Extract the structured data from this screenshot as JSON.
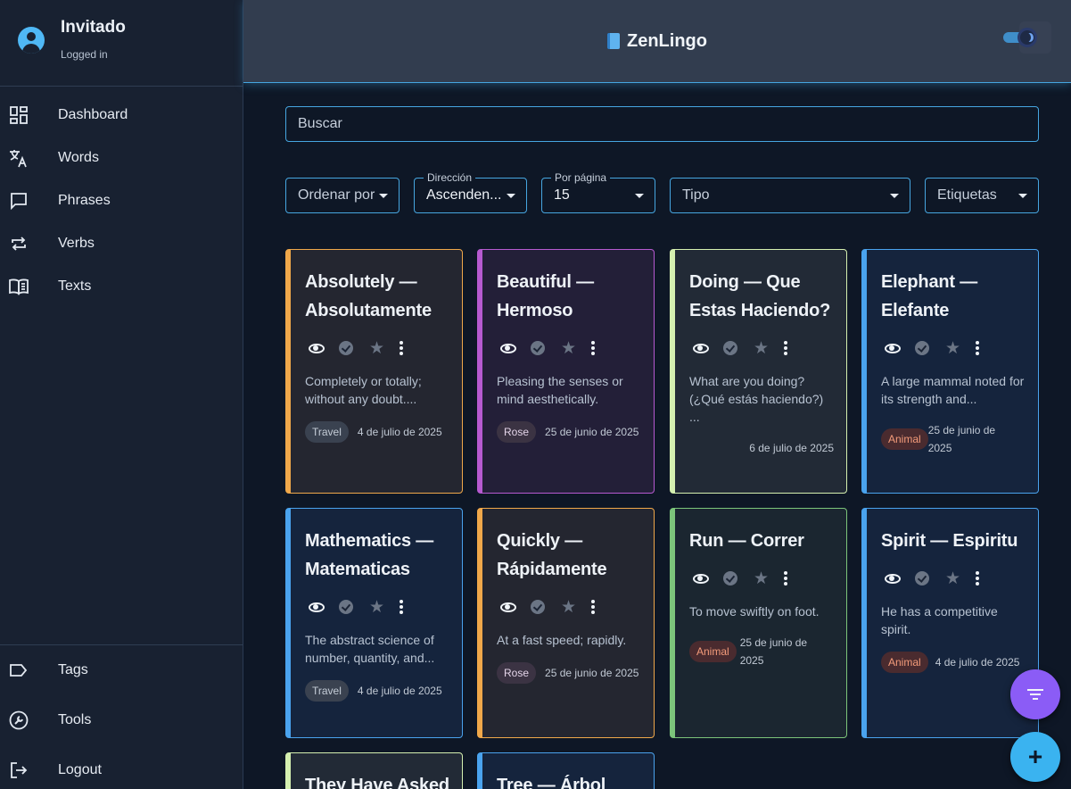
{
  "user": {
    "name": "Invitado",
    "status": "Logged in"
  },
  "sidebar": {
    "items": [
      {
        "label": "Dashboard",
        "icon": "dashboard-icon"
      },
      {
        "label": "Words",
        "icon": "translate-icon"
      },
      {
        "label": "Phrases",
        "icon": "chat-icon"
      },
      {
        "label": "Verbs",
        "icon": "repeat-icon"
      },
      {
        "label": "Texts",
        "icon": "book-open-icon"
      }
    ],
    "bottom": [
      {
        "label": "Tags",
        "icon": "tag-icon"
      },
      {
        "label": "Tools",
        "icon": "wrench-icon"
      },
      {
        "label": "Logout",
        "icon": "logout-icon"
      }
    ]
  },
  "header": {
    "title": "ZenLingo"
  },
  "search": {
    "placeholder": "Buscar"
  },
  "filters": {
    "sort": {
      "placeholder": "Ordenar por"
    },
    "direction": {
      "label": "Dirección",
      "value": "Ascenden..."
    },
    "per_page": {
      "label": "Por página",
      "value": "15"
    },
    "type": {
      "placeholder": "Tipo"
    },
    "tags": {
      "placeholder": "Etiquetas"
    }
  },
  "colors": {
    "accent": "#46a6e0",
    "card_orange": "#f0a84a",
    "card_purple": "#b65ad0",
    "card_lightgreen": "#d5f0b0",
    "card_blue": "#4aa3ee",
    "card_green": "#7cc47a"
  },
  "cards": [
    {
      "title": "Absolutely — Absolutamente",
      "description": "Completely or totally; without any doubt....",
      "tag": "Travel",
      "date": "4 de julio de 2025"
    },
    {
      "title": "Beautiful — Hermoso",
      "description": "Pleasing the senses or mind aesthetically.",
      "tag": "Rose",
      "date": "25 de junio de 2025"
    },
    {
      "title": "Doing — Que Estas Haciendo?",
      "description": "What are you doing? (¿Qué estás haciendo?) ...",
      "tag": "",
      "date": "6 de julio de 2025"
    },
    {
      "title": "Elephant — Elefante",
      "description": "A large mammal noted for its strength and...",
      "tag": "Animal",
      "date": "25 de junio de 2025"
    },
    {
      "title": "Mathematics — Matematicas",
      "description": "The abstract science of number, quantity, and...",
      "tag": "Travel",
      "date": "4 de julio de 2025"
    },
    {
      "title": "Quickly — Rápidamente",
      "description": "At a fast speed; rapidly.",
      "tag": "Rose",
      "date": "25 de junio de 2025"
    },
    {
      "title": "Run — Correr",
      "description": "To move swiftly on foot.",
      "tag": "Animal",
      "date": "25 de junio de 2025"
    },
    {
      "title": "Spirit — Espiritu",
      "description": "He has a competitive spirit.",
      "tag": "Animal",
      "date": "4 de julio de 2025"
    },
    {
      "title": "They Have Asked",
      "description": "",
      "tag": "",
      "date": ""
    },
    {
      "title": "Tree — Árbol",
      "description": "",
      "tag": "",
      "date": ""
    }
  ]
}
